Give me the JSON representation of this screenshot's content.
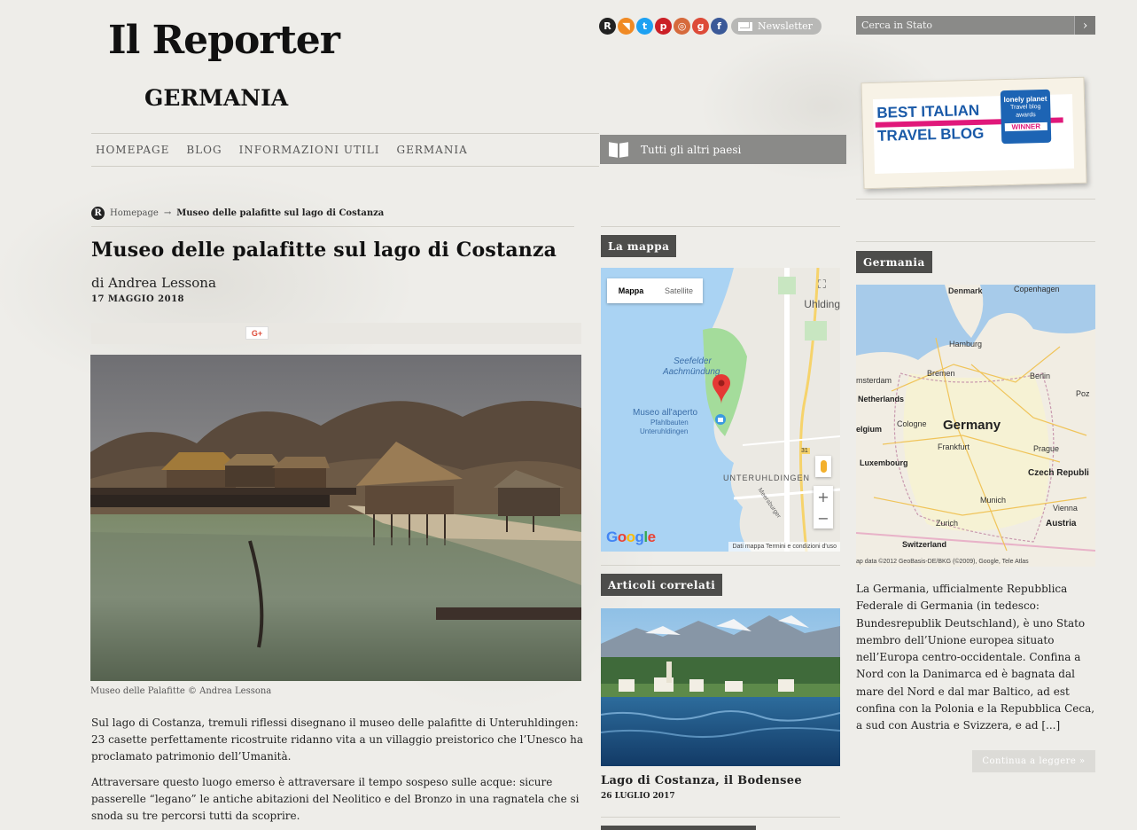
{
  "logo": {
    "title": "Il Reporter",
    "subtitle": "GERMANIA"
  },
  "nav": [
    "Homepage",
    "Blog",
    "Informazioni utili",
    "Germania"
  ],
  "other_countries": "Tutti gli altri paesi",
  "social": {
    "items": [
      {
        "icon": "reporter-icon",
        "glyph": "R",
        "color": "#222222"
      },
      {
        "icon": "rss-icon",
        "glyph": "◥",
        "color": "#f08a24"
      },
      {
        "icon": "twitter-icon",
        "glyph": "t",
        "color": "#1da1f2"
      },
      {
        "icon": "pinterest-icon",
        "glyph": "p",
        "color": "#cb2027"
      },
      {
        "icon": "instagram-icon",
        "glyph": "◎",
        "color": "#d66a3c"
      },
      {
        "icon": "googleplus-icon",
        "glyph": "g",
        "color": "#dd4b39"
      },
      {
        "icon": "facebook-icon",
        "glyph": "f",
        "color": "#3b5998"
      }
    ],
    "newsletter": "Newsletter"
  },
  "search": {
    "placeholder": "Cerca in Stato",
    "button": "›"
  },
  "badge": {
    "line1": "BEST ITALIAN",
    "line2": "TRAVEL BLOG",
    "lp_brand": "lonely planet",
    "lp_text": "Travel blog awards",
    "lp_winner": "WINNER"
  },
  "breadcrumb": {
    "home": "Homepage",
    "separator": "→",
    "current": "Museo delle palafitte sul lago di Costanza"
  },
  "article": {
    "title": "Museo delle palafitte sul lago di Costanza",
    "author": "di Andrea Lessona",
    "date": "17 MAGGIO 2018",
    "share_gplus": "G+",
    "caption": "Museo delle Palafitte © Andrea Lessona",
    "p1": "Sul lago di Costanza, tremuli riflessi disegnano il museo delle palafitte di Unteruhldingen: 23 casette perfettamente ricostruite ridanno vita a un villaggio preistorico che l’Unesco ha proclamato patrimonio dell’Umanità.",
    "p2": "Attraversare questo luogo emerso è attraversare il tempo sospeso sulle acque: sicure passerelle “legano” le antiche abitazioni del Neolitico e del Bronzo in una ragnatela che si snoda su tre percorsi tutti da scoprire."
  },
  "map_section": {
    "label": "La mappa",
    "type_map": "Mappa",
    "type_satellite": "Satellite",
    "places": {
      "uhldingen": "Uhlding",
      "seefelder": "Seefelder",
      "aachmundung": "Aachmündung",
      "museo": "Museo all'aperto",
      "pfahlbauten": "Pfahlbauten",
      "unteruhldingen_small": "Unteruhldingen",
      "unteruhldingen": "UNTERUHLDINGEN",
      "road": "31",
      "meersburger": "Meersburger"
    },
    "zoom_in": "+",
    "zoom_out": "−",
    "google": "Google",
    "footer": "Dati mappa   Termini e condizioni d'uso"
  },
  "related": {
    "label": "Articoli correlati",
    "title": "Lago di Costanza, il Bodensee",
    "date": "26 LUGLIO 2017"
  },
  "country": {
    "label": "Germania",
    "map_labels": {
      "denmark": "Denmark",
      "copenhagen": "Copenhagen",
      "hamburg": "Hamburg",
      "bremen": "Bremen",
      "berlin": "Berlin",
      "amsterdam": "msterdam",
      "netherlands": "Netherlands",
      "germany": "Germany",
      "belgium": "elgium",
      "cologne": "Cologne",
      "frankfurt": "Frankfurt",
      "prague": "Prague",
      "luxembourg": "Luxembourg",
      "czech": "Czech Republi",
      "munich": "Munich",
      "vienna": "Vienna",
      "zurich": "Zurich",
      "austria": "Austria",
      "switzerland": "Switzerland",
      "poz": "Poz",
      "copyright": "ap data ©2012 GeoBasis-DE/BKG (©2009), Google, Tele Atlas"
    },
    "description": "La Germania, ufficialmente Repubblica Federale di Germania (in tedesco: Bundesrepublik Deutschland), è uno Stato membro dell’Unione europea situato nell’Europa centro-occidentale. Confina a Nord con la Danimarca ed è bagnata dal mare del Nord e dal mar Baltico, ad est confina con la Polonia e la Repubblica Ceca, a sud con Austria e Svizzera, e ad [...]",
    "more": "Continua a leggere »"
  },
  "colors": {
    "label_bg": "#4d4d4b",
    "nav_bg": "#8a8a88",
    "accent_badge": "#1a5aa8",
    "marker": "#e53935"
  }
}
